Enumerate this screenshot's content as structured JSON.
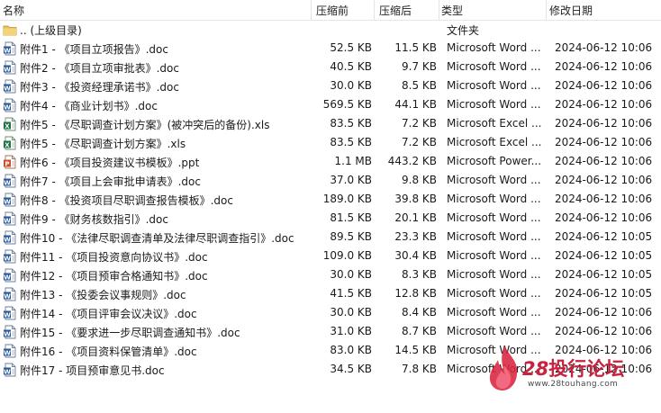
{
  "columns": {
    "name": "名称",
    "size": "压缩前",
    "compressed": "压缩后",
    "type": "类型",
    "modified": "修改日期"
  },
  "files": [
    {
      "icon": "folder-icon",
      "name": ".. (上级目录)",
      "size": "",
      "compressed": "",
      "type": "文件夹",
      "modified": ""
    },
    {
      "icon": "word-doc-icon",
      "name": "附件1 - 《项目立项报告》.doc",
      "size": "52.5 KB",
      "compressed": "11.5 KB",
      "type": "Microsoft Word ...",
      "modified": "2024-06-12 10:06"
    },
    {
      "icon": "word-doc-icon",
      "name": "附件2 - 《项目立项审批表》.doc",
      "size": "40.5 KB",
      "compressed": "9.7 KB",
      "type": "Microsoft Word ...",
      "modified": "2024-06-12 10:06"
    },
    {
      "icon": "word-doc-icon",
      "name": "附件3 - 《投资经理承诺书》.doc",
      "size": "30.0 KB",
      "compressed": "8.5 KB",
      "type": "Microsoft Word ...",
      "modified": "2024-06-12 10:06"
    },
    {
      "icon": "word-doc-icon",
      "name": "附件4 - 《商业计划书》.doc",
      "size": "569.5 KB",
      "compressed": "44.1 KB",
      "type": "Microsoft Word ...",
      "modified": "2024-06-12 10:06"
    },
    {
      "icon": "excel-xls-icon",
      "name": "附件5 - 《尽职调查计划方案》(被冲突后的备份).xls",
      "size": "83.5 KB",
      "compressed": "7.2 KB",
      "type": "Microsoft Excel ...",
      "modified": "2024-06-12 10:06"
    },
    {
      "icon": "excel-xls-icon",
      "name": "附件5 - 《尽职调查计划方案》.xls",
      "size": "83.5 KB",
      "compressed": "7.2 KB",
      "type": "Microsoft Excel ...",
      "modified": "2024-06-12 10:06"
    },
    {
      "icon": "powerpoint-ppt-icon",
      "name": "附件6 - 《项目投资建议书模板》.ppt",
      "size": "1.1 MB",
      "compressed": "443.2 KB",
      "type": "Microsoft Power...",
      "modified": "2024-06-12 10:06"
    },
    {
      "icon": "word-doc-icon",
      "name": "附件7 - 《项目上会审批申请表》.doc",
      "size": "37.0 KB",
      "compressed": "9.8 KB",
      "type": "Microsoft Word ...",
      "modified": "2024-06-12 10:06"
    },
    {
      "icon": "word-doc-icon",
      "name": "附件8 - 《投资项目尽职调查报告模板》.doc",
      "size": "189.0 KB",
      "compressed": "39.8 KB",
      "type": "Microsoft Word ...",
      "modified": "2024-06-12 10:06"
    },
    {
      "icon": "word-doc-icon",
      "name": "附件9 - 《财务核数指引》.doc",
      "size": "81.5 KB",
      "compressed": "20.1 KB",
      "type": "Microsoft Word ...",
      "modified": "2024-06-12 10:06"
    },
    {
      "icon": "word-doc-icon",
      "name": "附件10 - 《法律尽职调查清单及法律尽职调查指引》.doc",
      "size": "89.5 KB",
      "compressed": "23.3 KB",
      "type": "Microsoft Word ...",
      "modified": "2024-06-12 10:05"
    },
    {
      "icon": "word-doc-icon",
      "name": "附件11 - 《项目投资意向协议书》.doc",
      "size": "109.0 KB",
      "compressed": "30.4 KB",
      "type": "Microsoft Word ...",
      "modified": "2024-06-12 10:05"
    },
    {
      "icon": "word-doc-icon",
      "name": "附件12 - 《项目预审合格通知书》.doc",
      "size": "30.0 KB",
      "compressed": "8.3 KB",
      "type": "Microsoft Word ...",
      "modified": "2024-06-12 10:05"
    },
    {
      "icon": "word-doc-icon",
      "name": "附件13 - 《投委会议事规则》.doc",
      "size": "41.5 KB",
      "compressed": "12.8 KB",
      "type": "Microsoft Word ...",
      "modified": "2024-06-12 10:05"
    },
    {
      "icon": "word-doc-icon",
      "name": "附件14 - 《项目评审会议决议》.doc",
      "size": "30.0 KB",
      "compressed": "8.4 KB",
      "type": "Microsoft Word ...",
      "modified": "2024-06-12 10:06"
    },
    {
      "icon": "word-doc-icon",
      "name": "附件15 - 《要求进一步尽职调查通知书》.doc",
      "size": "31.0 KB",
      "compressed": "8.7 KB",
      "type": "Microsoft Word ...",
      "modified": "2024-06-12 10:06"
    },
    {
      "icon": "word-doc-icon",
      "name": "附件16 - 《项目资料保管清单》.doc",
      "size": "83.0 KB",
      "compressed": "14.5 KB",
      "type": "Microsoft Word ...",
      "modified": "2024-06-12 10:06"
    },
    {
      "icon": "word-doc-icon",
      "name": "附件17 - 项目预审意见书.doc",
      "size": "34.5 KB",
      "compressed": "7.8 KB",
      "type": "Microsoft Word ...",
      "modified": "2024-06-12 10:06"
    }
  ],
  "watermark": {
    "brand_number": "28",
    "brand_name": "投行论坛",
    "url": "www.28touhang.com",
    "color": "#c9213f"
  }
}
